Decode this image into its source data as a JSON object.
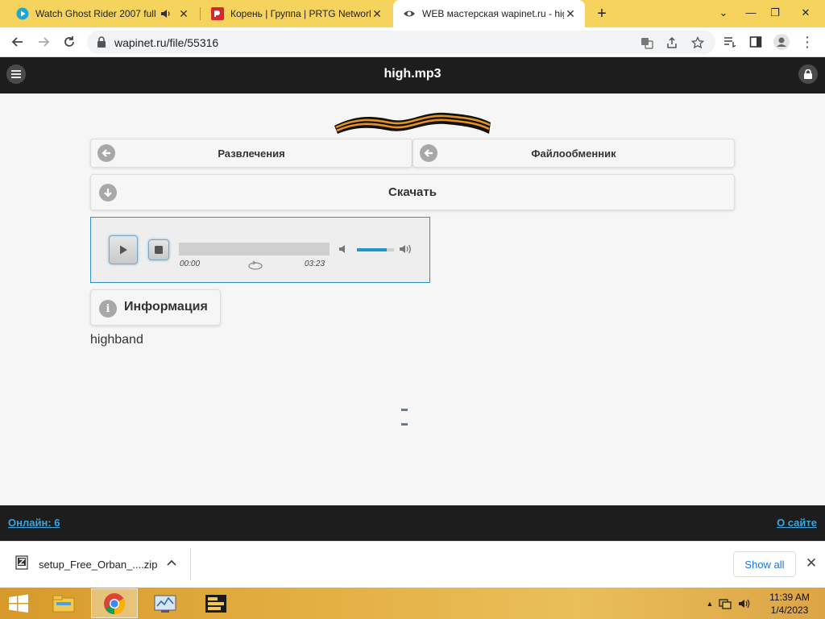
{
  "browser": {
    "tabs": [
      {
        "title": "Watch Ghost Rider 2007 full",
        "favicon": "play-circle-icon",
        "audio": true
      },
      {
        "title": "Корень | Группа | PRTG Network",
        "favicon": "prtg-icon"
      },
      {
        "title": "WEB мастерская wapinet.ru - hig",
        "favicon": "eye-icon"
      }
    ],
    "url": "wapinet.ru/file/55316"
  },
  "page": {
    "title": "high.mp3",
    "nav": {
      "back_label": "Развлечения",
      "forward_label": "Файлообменник"
    },
    "download_label": "Скачать",
    "player": {
      "current_time": "00:00",
      "duration": "03:23",
      "volume": 0.8
    },
    "info_label": "Информация",
    "info_text": "highband",
    "footer": {
      "online_label": "Онлайн: 6",
      "about_label": "О сайте"
    }
  },
  "downloads": {
    "file_name": "setup_Free_Orban_....zip",
    "show_all_label": "Show all"
  },
  "taskbar": {
    "time": "11:39 AM",
    "date": "1/4/2023"
  },
  "colors": {
    "tabstrip": "#f6d35c",
    "header": "#1d1d1d",
    "accent": "#2f90c8",
    "link": "#3aa5e0"
  }
}
